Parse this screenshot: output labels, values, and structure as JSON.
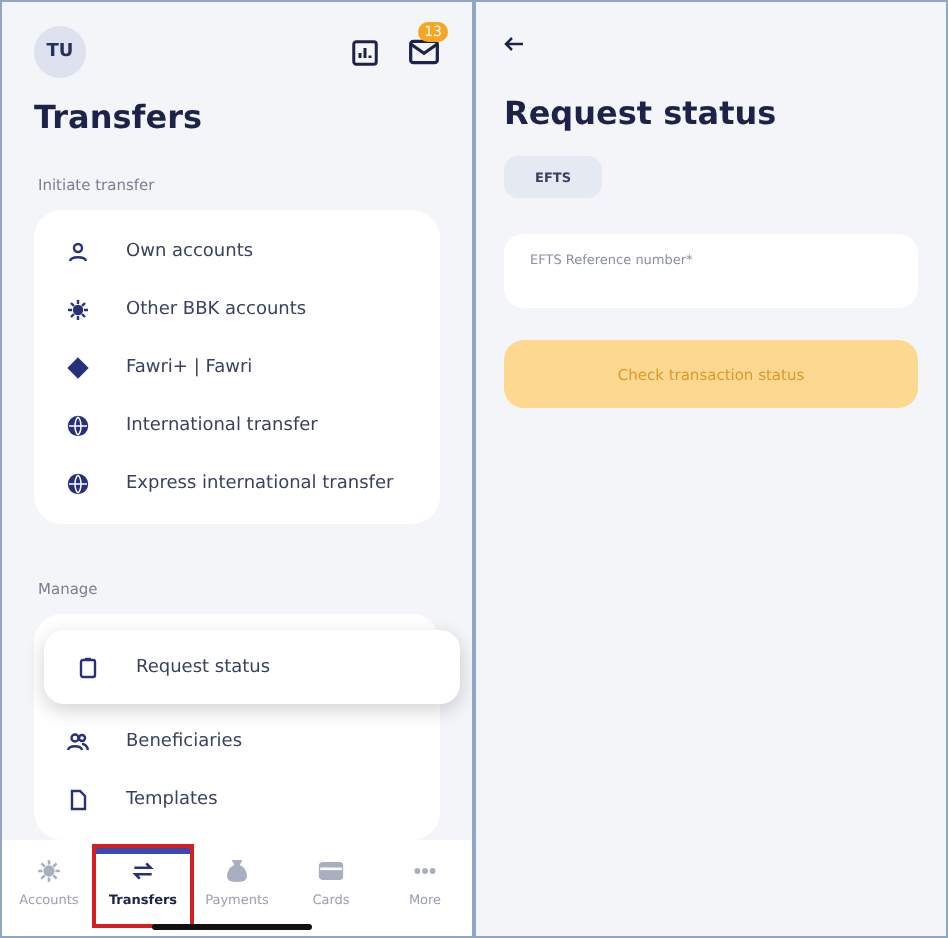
{
  "transfers_screen": {
    "avatar": "TU",
    "mail_badge": "13",
    "title": "Transfers",
    "initiate_section": {
      "label": "Initiate transfer",
      "items": [
        {
          "label": "Own accounts",
          "kind": "person"
        },
        {
          "label": "Other BBK accounts",
          "kind": "sun"
        },
        {
          "label": "Fawri+ | Fawri",
          "kind": "diamond"
        },
        {
          "label": "International transfer",
          "kind": "globe"
        },
        {
          "label": "Express international transfer",
          "kind": "globe"
        }
      ]
    },
    "manage_section": {
      "label": "Manage",
      "items": [
        {
          "label": "Request status",
          "kind": "clipboard",
          "selected": true
        },
        {
          "label": "Beneficiaries",
          "kind": "people",
          "selected": false
        },
        {
          "label": "Templates",
          "kind": "file",
          "selected": false
        }
      ]
    },
    "bottom_nav": [
      {
        "label": "Accounts",
        "kind": "sun",
        "selected": false
      },
      {
        "label": "Transfers",
        "kind": "arrows",
        "selected": true
      },
      {
        "label": "Payments",
        "kind": "bag",
        "selected": false
      },
      {
        "label": "Cards",
        "kind": "card",
        "selected": false
      },
      {
        "label": "More",
        "kind": "dots",
        "selected": false
      }
    ]
  },
  "request_status_screen": {
    "title": "Request status",
    "tab": "EFTS",
    "reference_field": {
      "placeholder": "EFTS Reference number*"
    },
    "check_button": {
      "label": "Check transaction status",
      "disabled": true
    }
  }
}
